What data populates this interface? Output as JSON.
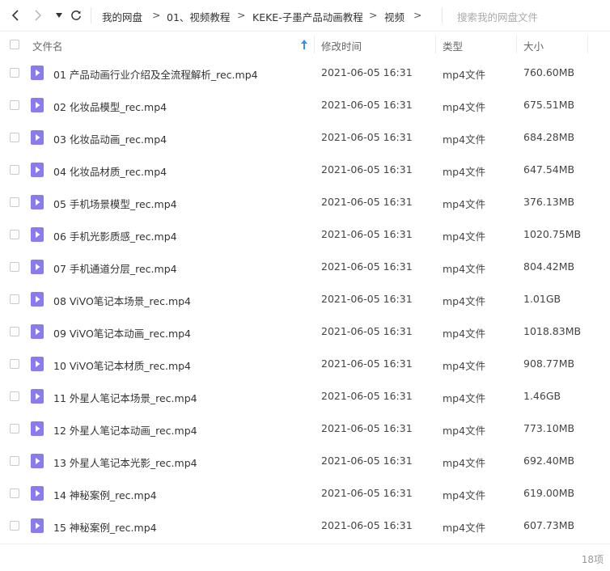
{
  "toolbar": {
    "back_icon": "chevron-left-icon",
    "forward_icon": "chevron-right-icon",
    "history_icon": "caret-down-icon",
    "refresh_icon": "refresh-icon",
    "breadcrumbs": [
      "我的网盘",
      "01、视频教程",
      "KEKE-子墨产品动画教程",
      "视频"
    ],
    "separator": ">",
    "search_placeholder": "搜索我的网盘文件"
  },
  "columns": {
    "name": "文件名",
    "modified": "修改时间",
    "type": "类型",
    "size": "大小",
    "sort_icon": "sort-up-arrow-icon"
  },
  "files": [
    {
      "name": "01 产品动画行业介绍及全流程解析_rec.mp4",
      "modified": "2021-06-05 16:31",
      "type": "mp4文件",
      "size": "760.60MB"
    },
    {
      "name": "02 化妆品模型_rec.mp4",
      "modified": "2021-06-05 16:31",
      "type": "mp4文件",
      "size": "675.51MB"
    },
    {
      "name": "03 化妆品动画_rec.mp4",
      "modified": "2021-06-05 16:31",
      "type": "mp4文件",
      "size": "684.28MB"
    },
    {
      "name": "04 化妆品材质_rec.mp4",
      "modified": "2021-06-05 16:31",
      "type": "mp4文件",
      "size": "647.54MB"
    },
    {
      "name": "05 手机场景模型_rec.mp4",
      "modified": "2021-06-05 16:31",
      "type": "mp4文件",
      "size": "376.13MB"
    },
    {
      "name": "06 手机光影质感_rec.mp4",
      "modified": "2021-06-05 16:31",
      "type": "mp4文件",
      "size": "1020.75MB"
    },
    {
      "name": "07 手机通道分层_rec.mp4",
      "modified": "2021-06-05 16:31",
      "type": "mp4文件",
      "size": "804.42MB"
    },
    {
      "name": "08 ViVO笔记本场景_rec.mp4",
      "modified": "2021-06-05 16:31",
      "type": "mp4文件",
      "size": "1.01GB"
    },
    {
      "name": "09 ViVO笔记本动画_rec.mp4",
      "modified": "2021-06-05 16:31",
      "type": "mp4文件",
      "size": "1018.83MB"
    },
    {
      "name": "10 ViVO笔记本材质_rec.mp4",
      "modified": "2021-06-05 16:31",
      "type": "mp4文件",
      "size": "908.77MB"
    },
    {
      "name": "11 外星人笔记本场景_rec.mp4",
      "modified": "2021-06-05 16:31",
      "type": "mp4文件",
      "size": "1.46GB"
    },
    {
      "name": "12 外星人笔记本动画_rec.mp4",
      "modified": "2021-06-05 16:31",
      "type": "mp4文件",
      "size": "773.10MB"
    },
    {
      "name": "13 外星人笔记本光影_rec.mp4",
      "modified": "2021-06-05 16:31",
      "type": "mp4文件",
      "size": "692.40MB"
    },
    {
      "name": "14 神秘案例_rec.mp4",
      "modified": "2021-06-05 16:31",
      "type": "mp4文件",
      "size": "619.00MB"
    },
    {
      "name": "15 神秘案例_rec.mp4",
      "modified": "2021-06-05 16:31",
      "type": "mp4文件",
      "size": "607.73MB"
    }
  ],
  "file_icon": "video-file-icon",
  "colors": {
    "file_icon": "#8a7cf0",
    "accent": "#3a8ef6"
  },
  "footer": {
    "item_count": "18项"
  }
}
